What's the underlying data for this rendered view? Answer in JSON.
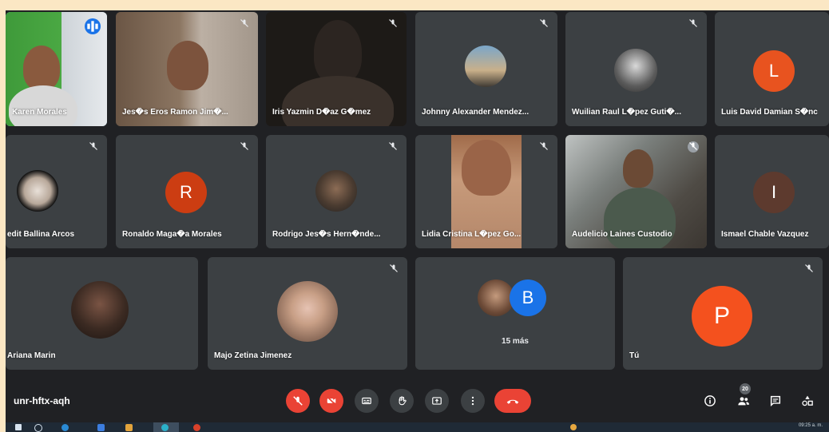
{
  "meeting": {
    "code": "unr-hftx-aqh"
  },
  "participants_row1": [
    {
      "name": "Karen Morales"
    },
    {
      "name": "Jes�s Eros Ramon Jim�..."
    },
    {
      "name": "Iris Yazmin D�az G�mez"
    },
    {
      "name": "Johnny Alexander Mendez..."
    },
    {
      "name": "Wuilian Raul L�pez Guti�..."
    },
    {
      "name": "Luis David Damian S�nc",
      "avatar_letter": "L",
      "avatar_color": "#e8531f"
    }
  ],
  "participants_row2": [
    {
      "name": "edit Ballina Arcos"
    },
    {
      "name": "Ronaldo Maga�a Morales",
      "avatar_letter": "R",
      "avatar_color": "#cc3d12"
    },
    {
      "name": "Rodrigo Jes�s Hern�nde..."
    },
    {
      "name": "Lidia Cristina L�pez Go..."
    },
    {
      "name": "Audelicio Laines Custodio"
    },
    {
      "name": "Ismael Chable Vazquez",
      "avatar_letter": "I",
      "avatar_color": "#5d3a2e"
    }
  ],
  "participants_row3": [
    {
      "name": "Ariana Marin"
    },
    {
      "name": "Majo Zetina Jimenez"
    },
    {
      "name": "15 más",
      "avatar_letter": "B",
      "avatar_color": "#1a73e8"
    },
    {
      "name": "Tú",
      "avatar_letter": "P",
      "avatar_color": "#f4511e"
    }
  ],
  "people_count": "20",
  "clock": "09:25 a. m.",
  "icons": {
    "mic_off": "mic-off-icon",
    "cam_off": "camera-off-icon",
    "captions": "captions-icon",
    "hand": "raise-hand-icon",
    "present": "present-icon",
    "more": "more-options-icon",
    "hangup": "hangup-icon",
    "info": "info-icon",
    "people": "people-icon",
    "chat": "chat-icon",
    "activities": "activities-icon"
  },
  "colors": {
    "tile": "#3c4043",
    "background": "#202124",
    "danger": "#ea4335",
    "accent": "#1a73e8"
  }
}
